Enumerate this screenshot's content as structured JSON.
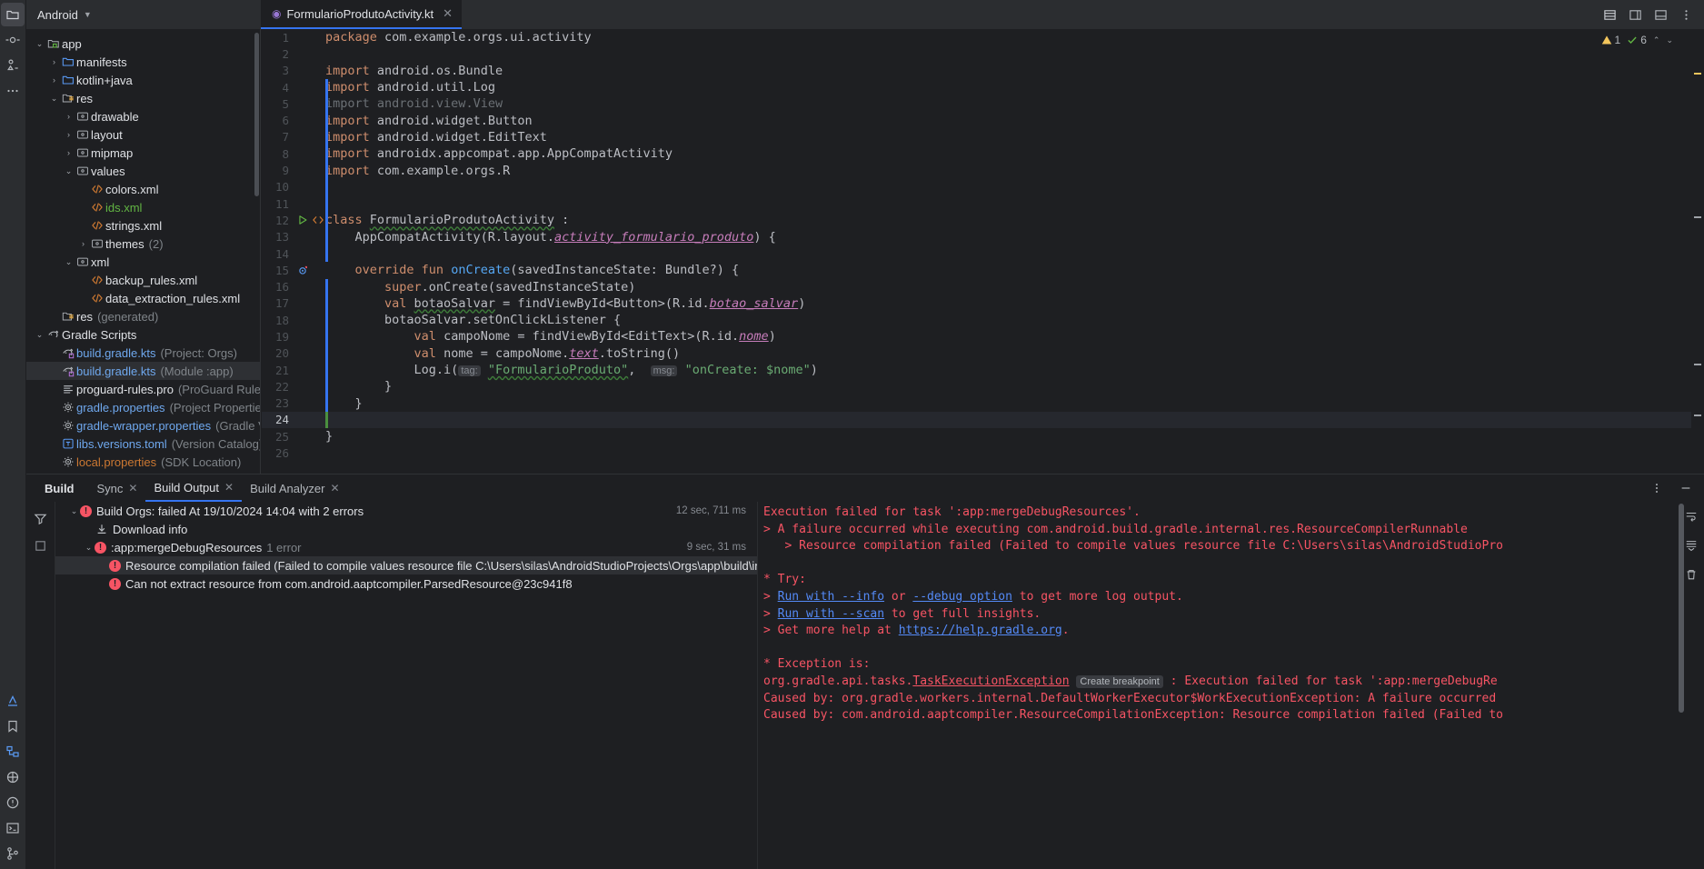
{
  "window": {
    "project_name": "Android",
    "editor_tab": "FormularioProdutoActivity.kt"
  },
  "rail": {
    "top_icons": [
      "project-folder-icon",
      "commit-icon",
      "pull-requests-icon",
      "more-icon"
    ],
    "bottom_icons": [
      "build-icon",
      "bookmarks-icon",
      "structure-icon",
      "device-manager-icon",
      "running-devices-icon",
      "problems-icon",
      "terminal-icon",
      "version-control-icon"
    ]
  },
  "project_tree": [
    {
      "indent": 0,
      "arrow": "down",
      "icon": "module-folder-icon",
      "label": "app",
      "label_color": "plain",
      "sub": ""
    },
    {
      "indent": 1,
      "arrow": "right",
      "icon": "folder-icon",
      "label": "manifests",
      "label_color": "plain",
      "sub": ""
    },
    {
      "indent": 1,
      "arrow": "right",
      "icon": "folder-icon",
      "label": "kotlin+java",
      "label_color": "plain",
      "sub": ""
    },
    {
      "indent": 1,
      "arrow": "down",
      "icon": "res-folder-icon",
      "label": "res",
      "label_color": "plain",
      "sub": ""
    },
    {
      "indent": 2,
      "arrow": "right",
      "icon": "res-sub-icon",
      "label": "drawable",
      "label_color": "plain",
      "sub": ""
    },
    {
      "indent": 2,
      "arrow": "right",
      "icon": "res-sub-icon",
      "label": "layout",
      "label_color": "plain",
      "sub": ""
    },
    {
      "indent": 2,
      "arrow": "right",
      "icon": "res-sub-icon",
      "label": "mipmap",
      "label_color": "plain",
      "sub": ""
    },
    {
      "indent": 2,
      "arrow": "down",
      "icon": "res-sub-icon",
      "label": "values",
      "label_color": "plain",
      "sub": ""
    },
    {
      "indent": 3,
      "arrow": "none",
      "icon": "xml-file-icon",
      "label": "colors.xml",
      "label_color": "plain",
      "sub": ""
    },
    {
      "indent": 3,
      "arrow": "none",
      "icon": "xml-file-icon",
      "label": "ids.xml",
      "label_color": "green",
      "sub": ""
    },
    {
      "indent": 3,
      "arrow": "none",
      "icon": "xml-file-icon",
      "label": "strings.xml",
      "label_color": "plain",
      "sub": ""
    },
    {
      "indent": 3,
      "arrow": "right",
      "icon": "res-sub-icon",
      "label": "themes",
      "label_color": "plain",
      "sub": "(2)"
    },
    {
      "indent": 2,
      "arrow": "down",
      "icon": "res-sub-icon",
      "label": "xml",
      "label_color": "plain",
      "sub": ""
    },
    {
      "indent": 3,
      "arrow": "none",
      "icon": "xml-file-icon",
      "label": "backup_rules.xml",
      "label_color": "plain",
      "sub": ""
    },
    {
      "indent": 3,
      "arrow": "none",
      "icon": "xml-file-icon",
      "label": "data_extraction_rules.xml",
      "label_color": "plain",
      "sub": ""
    },
    {
      "indent": 1,
      "arrow": "none",
      "icon": "res-folder-icon",
      "label": "res",
      "label_color": "plain",
      "sub": "(generated)"
    },
    {
      "indent": 0,
      "arrow": "down",
      "icon": "gradle-icon",
      "label": "Gradle Scripts",
      "label_color": "plain",
      "sub": ""
    },
    {
      "indent": 1,
      "arrow": "none",
      "icon": "gradle-script-icon",
      "label": "build.gradle.kts",
      "label_color": "blue",
      "sub": "(Project: Orgs)"
    },
    {
      "indent": 1,
      "arrow": "none",
      "icon": "gradle-script-icon",
      "label": "build.gradle.kts",
      "label_color": "blue",
      "sub": "(Module :app)",
      "selected": true
    },
    {
      "indent": 1,
      "arrow": "none",
      "icon": "properties-file-icon",
      "label": "proguard-rules.pro",
      "label_color": "plain",
      "sub": "(ProGuard Rules for \":app\")"
    },
    {
      "indent": 1,
      "arrow": "none",
      "icon": "gear-file-icon",
      "label": "gradle.properties",
      "label_color": "blue",
      "sub": "(Project Properties)"
    },
    {
      "indent": 1,
      "arrow": "none",
      "icon": "gear-file-icon",
      "label": "gradle-wrapper.properties",
      "label_color": "blue",
      "sub": "(Gradle Version)"
    },
    {
      "indent": 1,
      "arrow": "none",
      "icon": "toml-file-icon",
      "label": "libs.versions.toml",
      "label_color": "blue",
      "sub": "(Version Catalog)"
    },
    {
      "indent": 1,
      "arrow": "none",
      "icon": "gear-file-icon",
      "label": "local.properties",
      "label_color": "orange",
      "sub": "(SDK Location)"
    }
  ],
  "editor": {
    "inspection": {
      "warnings": "1",
      "checks": "6"
    },
    "current_line": 24,
    "lines": [
      {
        "n": 1,
        "tokens": [
          {
            "t": "package ",
            "c": "kw"
          },
          {
            "t": "com.example.orgs.ui.activity",
            "c": "id"
          }
        ]
      },
      {
        "n": 2,
        "tokens": []
      },
      {
        "n": 3,
        "tokens": [
          {
            "t": "import ",
            "c": "kw"
          },
          {
            "t": "android.os.Bundle",
            "c": "id"
          }
        ]
      },
      {
        "n": 4,
        "tokens": [
          {
            "t": "import ",
            "c": "kw"
          },
          {
            "t": "android.util.Log",
            "c": "id"
          }
        ]
      },
      {
        "n": 5,
        "tokens": [
          {
            "t": "import ",
            "c": "grey"
          },
          {
            "t": "android.view.View",
            "c": "grey"
          }
        ]
      },
      {
        "n": 6,
        "tokens": [
          {
            "t": "import ",
            "c": "kw"
          },
          {
            "t": "android.widget.Button",
            "c": "id"
          }
        ]
      },
      {
        "n": 7,
        "tokens": [
          {
            "t": "import ",
            "c": "kw"
          },
          {
            "t": "android.widget.EditText",
            "c": "id"
          }
        ]
      },
      {
        "n": 8,
        "tokens": [
          {
            "t": "import ",
            "c": "kw"
          },
          {
            "t": "androidx.appcompat.app.AppCompatActivity",
            "c": "id"
          }
        ]
      },
      {
        "n": 9,
        "tokens": [
          {
            "t": "import ",
            "c": "kw"
          },
          {
            "t": "com.example.orgs.R",
            "c": "id"
          }
        ]
      },
      {
        "n": 10,
        "tokens": []
      },
      {
        "n": 11,
        "tokens": []
      },
      {
        "n": 12,
        "tokens": [
          {
            "t": "class ",
            "c": "kw"
          },
          {
            "t": "FormularioProdutoActivity",
            "c": "id sq"
          },
          {
            "t": " :",
            "c": "id"
          }
        ],
        "gutter": [
          "run-icon",
          "preview-icon"
        ]
      },
      {
        "n": 13,
        "tokens": [
          {
            "t": "    AppCompatActivity(R.layout.",
            "c": "id"
          },
          {
            "t": "activity_formulario_produto",
            "c": "prop"
          },
          {
            "t": ") {",
            "c": "id"
          }
        ]
      },
      {
        "n": 14,
        "tokens": []
      },
      {
        "n": 15,
        "tokens": [
          {
            "t": "    ",
            "c": "id"
          },
          {
            "t": "override fun ",
            "c": "kw"
          },
          {
            "t": "onCreate",
            "c": "fn"
          },
          {
            "t": "(savedInstanceState: Bundle?) {",
            "c": "id"
          }
        ],
        "gutter": [
          "override-icon"
        ]
      },
      {
        "n": 16,
        "tokens": [
          {
            "t": "        ",
            "c": "id"
          },
          {
            "t": "super",
            "c": "kw"
          },
          {
            "t": ".onCreate(savedInstanceState)",
            "c": "id"
          }
        ]
      },
      {
        "n": 17,
        "tokens": [
          {
            "t": "        ",
            "c": "id"
          },
          {
            "t": "val ",
            "c": "kw"
          },
          {
            "t": "botaoSalvar",
            "c": "id sq"
          },
          {
            "t": " = findViewById<Button>(R.id.",
            "c": "id"
          },
          {
            "t": "botao_salvar",
            "c": "prop"
          },
          {
            "t": ")",
            "c": "id"
          }
        ]
      },
      {
        "n": 18,
        "tokens": [
          {
            "t": "        botaoSalvar.setOnClickListener {",
            "c": "id"
          }
        ]
      },
      {
        "n": 19,
        "tokens": [
          {
            "t": "            ",
            "c": "id"
          },
          {
            "t": "val ",
            "c": "kw"
          },
          {
            "t": "campoNome = findViewById<EditText>(R.id.",
            "c": "id"
          },
          {
            "t": "nome",
            "c": "prop"
          },
          {
            "t": ")",
            "c": "id"
          }
        ]
      },
      {
        "n": 20,
        "tokens": [
          {
            "t": "            ",
            "c": "id"
          },
          {
            "t": "val ",
            "c": "kw"
          },
          {
            "t": "nome = campoNome.",
            "c": "id"
          },
          {
            "t": "text",
            "c": "prop"
          },
          {
            "t": ".toString()",
            "c": "id"
          }
        ]
      },
      {
        "n": 21,
        "tokens": [
          {
            "t": "            Log.i(",
            "c": "id"
          },
          {
            "t": "tag:",
            "c": "hintk"
          },
          {
            "t": " ",
            "c": "id"
          },
          {
            "t": "\"FormularioProduto\"",
            "c": "str sq"
          },
          {
            "t": ",  ",
            "c": "id"
          },
          {
            "t": "msg:",
            "c": "hintk"
          },
          {
            "t": " ",
            "c": "id"
          },
          {
            "t": "\"onCreate: $nome\"",
            "c": "str"
          },
          {
            "t": ")",
            "c": "id"
          }
        ]
      },
      {
        "n": 22,
        "tokens": [
          {
            "t": "        }",
            "c": "id"
          }
        ]
      },
      {
        "n": 23,
        "tokens": [
          {
            "t": "    }",
            "c": "id"
          }
        ]
      },
      {
        "n": 24,
        "tokens": [],
        "current": true
      },
      {
        "n": 25,
        "tokens": [
          {
            "t": "}",
            "c": "id"
          }
        ]
      },
      {
        "n": 26,
        "tokens": []
      }
    ]
  },
  "bottom_panel": {
    "title": "Build",
    "tabs": [
      {
        "label": "Sync",
        "active": false,
        "closable": true
      },
      {
        "label": "Build Output",
        "active": true,
        "closable": true
      },
      {
        "label": "Build Analyzer",
        "active": false,
        "closable": true
      }
    ],
    "tree": [
      {
        "indent": 0,
        "arrow": "down",
        "icon": "error-icon",
        "label": "Build Orgs: failed At 19/10/2024 14:04 with 2 errors",
        "time": "12 sec, 711 ms"
      },
      {
        "indent": 1,
        "arrow": "none",
        "icon": "download-icon",
        "label": "Download info",
        "time": ""
      },
      {
        "indent": 1,
        "arrow": "down",
        "icon": "error-icon",
        "label": ":app:mergeDebugResources",
        "suffix": "1 error",
        "time": "9 sec, 31 ms"
      },
      {
        "indent": 2,
        "arrow": "none",
        "icon": "error-dot-icon",
        "selected": true,
        "label": "Resource compilation failed (Failed to compile values resource file C:\\Users\\silas\\AndroidStudioProjects\\Orgs\\app\\build\\intermediate",
        "time": ""
      },
      {
        "indent": 2,
        "arrow": "none",
        "icon": "error-dot-icon",
        "label": "Can not extract resource from com.android.aaptcompiler.ParsedResource@23c941f8",
        "time": ""
      }
    ],
    "console": [
      {
        "segments": [
          {
            "t": "Execution failed for task ':app:mergeDebugResources'.",
            "c": "err"
          }
        ]
      },
      {
        "segments": [
          {
            "t": "> A failure occurred while executing com.android.build.gradle.internal.res.ResourceCompilerRunnable",
            "c": "err"
          }
        ]
      },
      {
        "segments": [
          {
            "t": "   > Resource compilation failed (Failed to compile values resource file C:\\Users\\silas\\AndroidStudioPro",
            "c": "err"
          }
        ]
      },
      {
        "segments": []
      },
      {
        "segments": [
          {
            "t": "* Try:",
            "c": "err"
          }
        ]
      },
      {
        "segments": [
          {
            "t": "> ",
            "c": "err"
          },
          {
            "t": "Run with --info",
            "c": "link"
          },
          {
            "t": " or ",
            "c": "err"
          },
          {
            "t": "--debug option",
            "c": "link"
          },
          {
            "t": " to get more log output.",
            "c": "err"
          }
        ]
      },
      {
        "segments": [
          {
            "t": "> ",
            "c": "err"
          },
          {
            "t": "Run with --scan",
            "c": "link"
          },
          {
            "t": " to get full insights.",
            "c": "err"
          }
        ]
      },
      {
        "segments": [
          {
            "t": "> Get more help at ",
            "c": "err"
          },
          {
            "t": "https://help.gradle.org",
            "c": "link"
          },
          {
            "t": ".",
            "c": "err"
          }
        ]
      },
      {
        "segments": []
      },
      {
        "segments": [
          {
            "t": "* Exception is:",
            "c": "err"
          }
        ]
      },
      {
        "segments": [
          {
            "t": "org.gradle.api.tasks.",
            "c": "err"
          },
          {
            "t": "TaskExecutionException",
            "c": "err-under"
          },
          {
            "t": " ",
            "c": "err"
          },
          {
            "t": "Create breakpoint",
            "c": "badge"
          },
          {
            "t": " : Execution failed for task ':app:mergeDebugRe",
            "c": "err"
          }
        ]
      },
      {
        "segments": [
          {
            "t": "Caused by: org.gradle.workers.internal.DefaultWorkerExecutor$WorkExecutionException: A failure occurred",
            "c": "err"
          }
        ]
      },
      {
        "segments": [
          {
            "t": "Caused by: com.android.aaptcompiler.ResourceCompilationException: Resource compilation failed (Failed to",
            "c": "err"
          }
        ]
      }
    ]
  },
  "colors": {
    "accent_blue": "#3574f0",
    "error_red": "#f75464",
    "link_blue": "#548af7",
    "green": "#62b543",
    "bg": "#1e1f22",
    "panel_bg": "#2b2d30"
  }
}
